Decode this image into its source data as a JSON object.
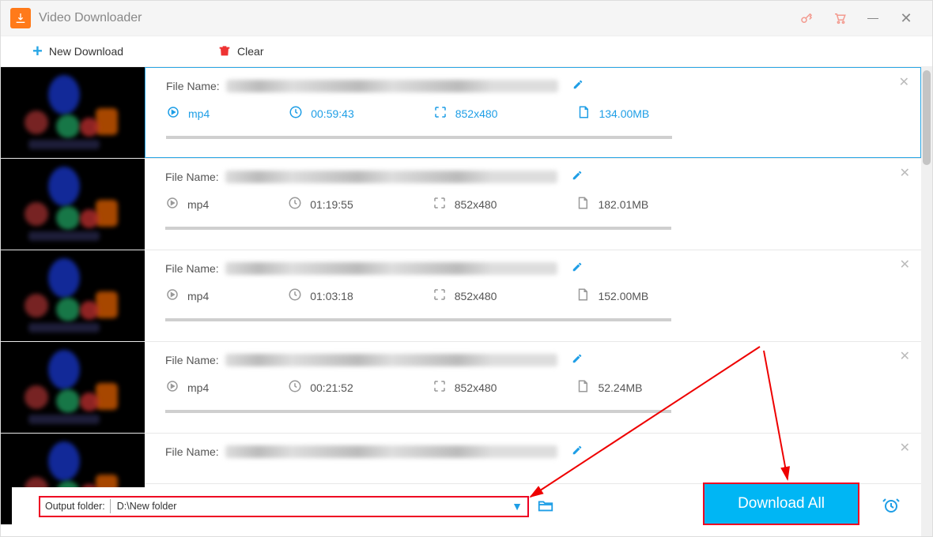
{
  "app": {
    "title": "Video Downloader"
  },
  "toolbar": {
    "new_download": "New Download",
    "clear": "Clear"
  },
  "labels": {
    "file_name": "File Name:"
  },
  "rows": [
    {
      "format": "mp4",
      "duration": "00:59:43",
      "resolution": "852x480",
      "size": "134.00MB",
      "selected": true
    },
    {
      "format": "mp4",
      "duration": "01:19:55",
      "resolution": "852x480",
      "size": "182.01MB",
      "selected": false
    },
    {
      "format": "mp4",
      "duration": "01:03:18",
      "resolution": "852x480",
      "size": "152.00MB",
      "selected": false
    },
    {
      "format": "mp4",
      "duration": "00:21:52",
      "resolution": "852x480",
      "size": "52.24MB",
      "selected": false
    },
    {
      "format": "",
      "duration": "",
      "resolution": "",
      "size": "",
      "selected": false
    }
  ],
  "output": {
    "label": "Output folder:",
    "path": "D:\\New folder"
  },
  "actions": {
    "download_all": "Download All"
  }
}
